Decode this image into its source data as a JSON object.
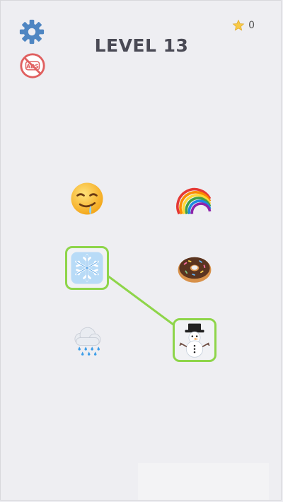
{
  "header": {
    "title": "LEVEL 13",
    "stars_count": "0",
    "settings_icon": "gear-icon",
    "no_ads_icon": "no-ads-icon",
    "star_icon": "star-icon"
  },
  "board": {
    "left_column": [
      {
        "name": "drooling-face",
        "emoji": "🤤",
        "selected": false
      },
      {
        "name": "snowflake",
        "emoji": "❄️",
        "selected": true
      },
      {
        "name": "cloud-with-rain",
        "emoji": "🌧️",
        "selected": false
      }
    ],
    "right_column": [
      {
        "name": "rainbow",
        "emoji": "🌈",
        "selected": false
      },
      {
        "name": "doughnut",
        "emoji": "🍩",
        "selected": false
      },
      {
        "name": "snowman",
        "emoji": "⛄",
        "selected": true
      }
    ],
    "connections": [
      {
        "from": "snowflake",
        "to": "snowman"
      }
    ]
  },
  "colors": {
    "background": "#eeeef2",
    "accent_green": "#8ed54a",
    "gear_blue": "#4f86c2",
    "no_ads_red": "#e06060",
    "title_gray": "#4a4a55"
  }
}
